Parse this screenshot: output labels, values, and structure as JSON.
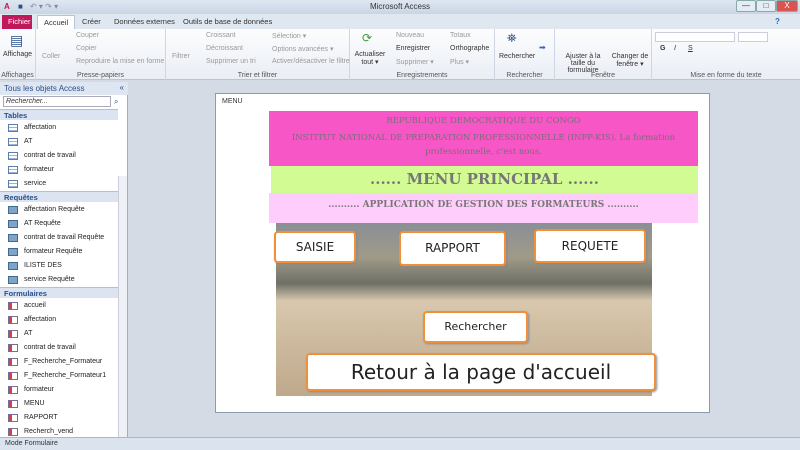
{
  "window": {
    "title": "Microsoft Access",
    "min": "—",
    "max": "□",
    "close": "X"
  },
  "tabs": [
    "Fichier",
    "Accueil",
    "Créer",
    "Données externes",
    "Outils de base de données"
  ],
  "ribbon": {
    "affichages": {
      "button": "Affichage",
      "label": "Affichages"
    },
    "presse": {
      "coller": "Coller",
      "couper": "Couper",
      "copier": "Copier",
      "reproduire": "Reproduire la mise en forme",
      "label": "Presse-papiers"
    },
    "trier": {
      "filtrer": "Filtrer",
      "croissant": "Croissant",
      "decroissant": "Décroissant",
      "supprimer_tri": "Supprimer un tri",
      "selection": "Sélection ▾",
      "options": "Options avancées ▾",
      "activer": "Activer/désactiver le filtre",
      "label": "Trier et filtrer"
    },
    "enreg": {
      "actualiser": "Actualiser tout ▾",
      "nouveau": "Nouveau",
      "enregistrer": "Enregistrer",
      "supprimer": "Supprimer ▾",
      "totaux": "Totaux",
      "orthographe": "Orthographe",
      "plus": "Plus ▾",
      "label": "Enregistrements"
    },
    "rechercher": {
      "button": "Rechercher",
      "label": "Rechercher"
    },
    "fenetre": {
      "ajuster": "Ajuster à la taille du formulaire",
      "changer": "Changer de fenêtre ▾",
      "label": "Fenêtre"
    },
    "texte": {
      "label": "Mise en forme du texte",
      "g": "G",
      "i": "I",
      "s": "S"
    }
  },
  "nav": {
    "title": "Tous les objets Access",
    "search_placeholder": "Rechercher...",
    "sections": [
      {
        "name": "Tables",
        "items": [
          "affectation",
          "AT",
          "contrat de travail",
          "formateur",
          "service"
        ]
      },
      {
        "name": "Requêtes",
        "items": [
          "affectation Requête",
          "AT Requête",
          "contrat de travail Requête",
          "formateur Requête",
          "ILISTE DES",
          "service Requête"
        ]
      },
      {
        "name": "Formulaires",
        "items": [
          "accueil",
          "affectation",
          "AT",
          "contrat de travail",
          "F_Recherche_Formateur",
          "F_Recherche_Formateur1",
          "formateur",
          "MENU",
          "RAPPORT",
          "Recherch_vend"
        ]
      }
    ]
  },
  "form": {
    "title": "MENU",
    "line1": "REPUBLIQUE DEMOCRATIQUE DU CONGO",
    "line2": "INSTITUT NATIONAL DE PREPARATION PROFESSIONNELLE (INPP-KIS). La formation professionnelle, c'est nous.",
    "menu": "...... MENU PRINCIPAL ......",
    "app": ".......... APPLICATION DE GESTION DES FORMATEURS ..........",
    "buttons": {
      "saisie": "SAISIE",
      "rapport": "RAPPORT",
      "requete": "REQUETE",
      "rechercher": "Rechercher",
      "retour": "Retour à la page d'accueil"
    }
  },
  "status": "Mode Formulaire"
}
